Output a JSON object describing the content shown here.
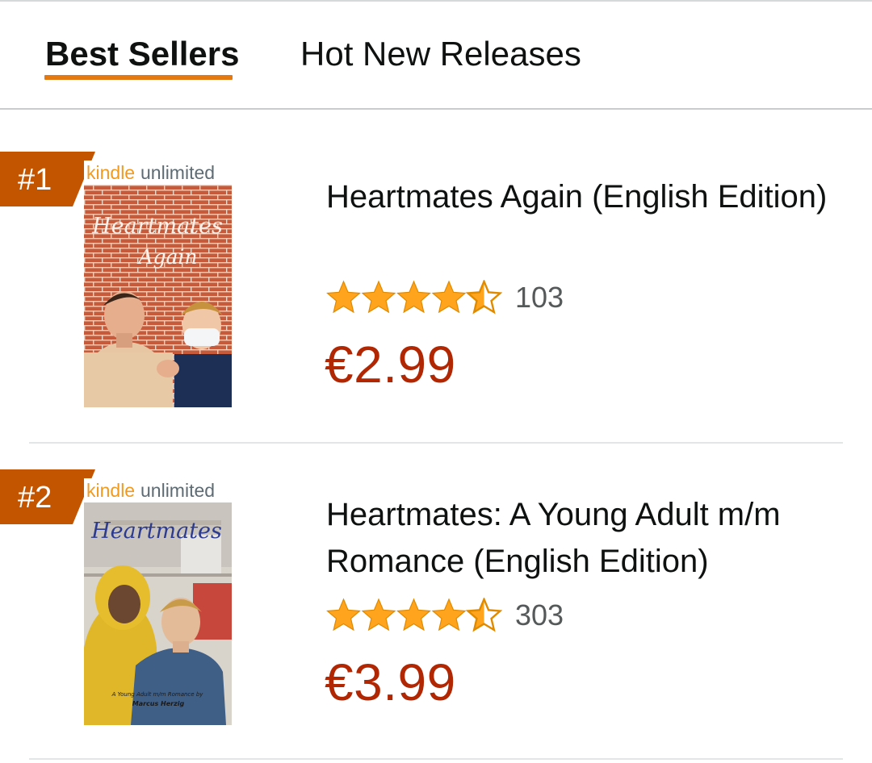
{
  "tabs": [
    {
      "label": "Best Sellers",
      "active": true
    },
    {
      "label": "Hot New Releases",
      "active": false
    }
  ],
  "colors": {
    "accent_underline": "#e47911",
    "rank_badge": "#c45500",
    "price": "#b12704",
    "star": "#ffa41c"
  },
  "items": [
    {
      "rank": "#1",
      "cover_brand": "kindleunlimited",
      "cover_title": "Heartmates Again",
      "title": "Heartmates Again (English Edition)",
      "rating": 4.5,
      "reviews": "103",
      "price": "€2.99"
    },
    {
      "rank": "#2",
      "cover_brand": "kindleunlimited",
      "cover_title": "Heartmates",
      "cover_tagline": "A Young Adult m/m Romance by",
      "cover_author": "Marcus Herzig",
      "title": "Heartmates: A Young Adult m/m Romance (English Edition)",
      "rating": 4.5,
      "reviews": "303",
      "price": "€3.99"
    }
  ]
}
